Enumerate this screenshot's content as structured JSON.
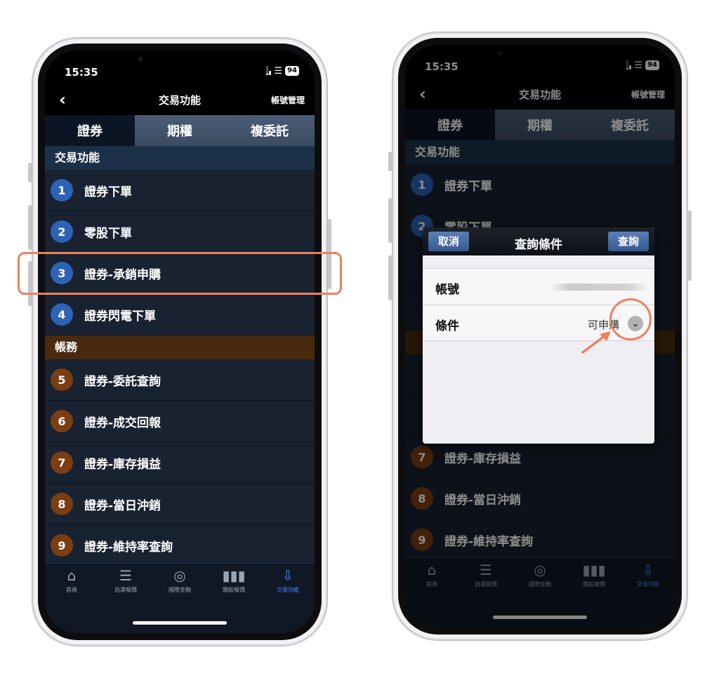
{
  "colors": {
    "highlight": "#ef7f5d",
    "accent_blue": "#2d63b4",
    "accent_brown": "#7a3e12"
  },
  "left": {
    "status": {
      "time": "15:35",
      "battery": "94"
    },
    "nav": {
      "title": "交易功能",
      "account": "帳號管理"
    },
    "tabs": [
      "證券",
      "期權",
      "複委託"
    ],
    "section1": "交易功能",
    "rows1": [
      {
        "num": "1",
        "label": "證券下單"
      },
      {
        "num": "2",
        "label": "零股下單"
      },
      {
        "num": "3",
        "label": "證券-承銷申購"
      },
      {
        "num": "4",
        "label": "證券閃電下單"
      }
    ],
    "section2": "帳務",
    "rows2": [
      {
        "num": "5",
        "label": "證券-委託查詢"
      },
      {
        "num": "6",
        "label": "證券-成交回報"
      },
      {
        "num": "7",
        "label": "證券-庫存損益"
      },
      {
        "num": "8",
        "label": "證券-當日沖銷"
      },
      {
        "num": "9",
        "label": "證券-維持率查詢"
      }
    ],
    "tabbar": [
      {
        "icon": "home-icon",
        "label": "首頁"
      },
      {
        "icon": "list-icon",
        "label": "自選報價"
      },
      {
        "icon": "globe-icon",
        "label": "國際金融"
      },
      {
        "icon": "chart-icon",
        "label": "類股報價"
      },
      {
        "icon": "download-icon",
        "label": "交易功能"
      }
    ]
  },
  "right": {
    "status": {
      "time": "15:35",
      "battery": "94"
    },
    "nav": {
      "title": "交易功能",
      "account": "帳號管理"
    },
    "tabs": [
      "證券",
      "期權",
      "複委託"
    ],
    "section1": "交易功能",
    "rows_visible": [
      {
        "num": "1",
        "label": "證券下單"
      },
      {
        "num": "2",
        "label": "零股下單"
      },
      {
        "num": "7",
        "label": "證券-庫存損益"
      },
      {
        "num": "8",
        "label": "證券-當日沖銷"
      },
      {
        "num": "9",
        "label": "證券-維持率查詢"
      }
    ],
    "dialog": {
      "cancel": "取消",
      "title": "查詢條件",
      "query": "查詢",
      "account_label": "帳號",
      "condition_label": "條件",
      "condition_value": "可申購"
    },
    "tabbar": [
      {
        "icon": "home-icon",
        "label": "首頁"
      },
      {
        "icon": "list-icon",
        "label": "自選報價"
      },
      {
        "icon": "globe-icon",
        "label": "國際金融"
      },
      {
        "icon": "chart-icon",
        "label": "類股報價"
      },
      {
        "icon": "download-icon",
        "label": "交易功能"
      }
    ]
  }
}
